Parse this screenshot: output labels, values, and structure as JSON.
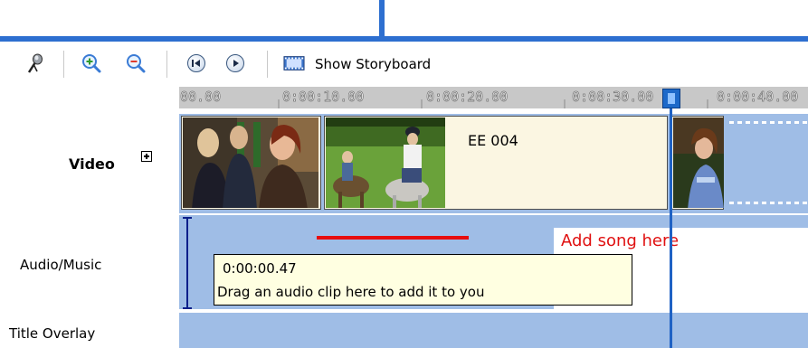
{
  "toolbar": {
    "icons": [
      "microphone-icon",
      "zoom-in-icon",
      "zoom-out-icon",
      "rewind-icon",
      "play-icon",
      "storyboard-icon"
    ],
    "storyboard_label": "Show Storyboard"
  },
  "ruler": {
    "ticks": [
      "00.00",
      "0:00:10.00",
      "0:00:20.00",
      "0:00:30.00",
      "0:00:40.00"
    ]
  },
  "tracks": {
    "video": {
      "label": "Video",
      "clips": [
        {
          "title": ""
        },
        {
          "title": "EE 004"
        },
        {
          "title": ""
        }
      ]
    },
    "audio": {
      "label": "Audio/Music",
      "annotation": "Add song here",
      "tooltip": {
        "time": "0:00:00.47",
        "message": "Drag an audio clip here to add it to you"
      }
    },
    "title_overlay": {
      "label": "Title Overlay"
    }
  },
  "colors": {
    "accent": "#2d6fd0",
    "track_bg": "#9fbde6",
    "annotation": "#e01010",
    "tooltip_bg": "#ffffe1"
  }
}
